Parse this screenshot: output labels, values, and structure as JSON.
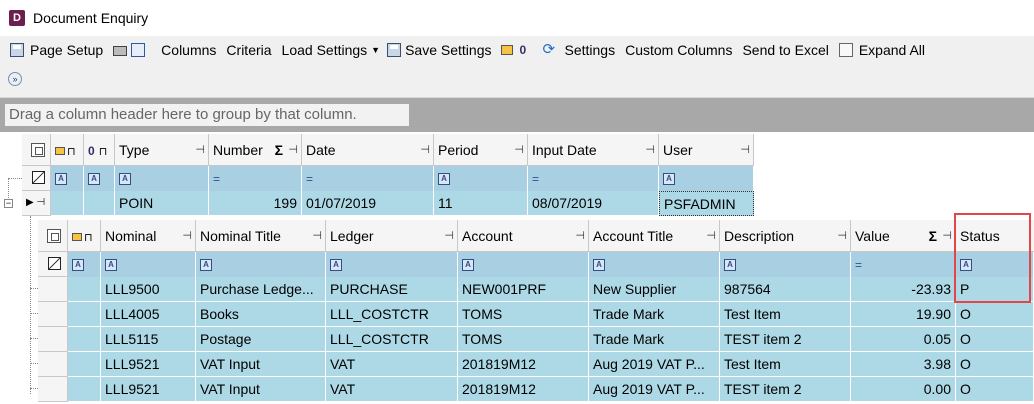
{
  "window": {
    "title": "Document Enquiry",
    "app_icon_letter": "D"
  },
  "toolbar": {
    "page_setup": "Page Setup",
    "columns": "Columns",
    "criteria": "Criteria",
    "load_settings": "Load Settings",
    "save_settings": "Save Settings",
    "zero_indicator": "0",
    "settings": "Settings",
    "custom_columns": "Custom Columns",
    "send_to_excel": "Send to Excel",
    "expand_all": "Expand All"
  },
  "group_panel": {
    "placeholder": "Drag a column header here to group by that column."
  },
  "master_grid": {
    "columns": [
      "Type",
      "Number",
      "Date",
      "Period",
      "Input Date",
      "User"
    ],
    "extra_col_label": "0",
    "row": {
      "type": "POIN",
      "number": "199",
      "date": "01/07/2019",
      "period": "11",
      "input_date": "08/07/2019",
      "user": "PSFADMIN"
    }
  },
  "detail_grid": {
    "columns": [
      "Nominal",
      "Nominal Title",
      "Ledger",
      "Account",
      "Account Title",
      "Description",
      "Value",
      "Status"
    ],
    "rows": [
      {
        "nominal": "LLL9500",
        "nominal_title": "Purchase  Ledge...",
        "ledger": "PURCHASE",
        "account": "NEW001PRF",
        "account_title": "New Supplier",
        "description": "987564",
        "value": "-23.93",
        "status": "P"
      },
      {
        "nominal": "LLL4005",
        "nominal_title": "Books",
        "ledger": "LLL_COSTCTR",
        "account": "TOMS",
        "account_title": "Trade Mark",
        "description": "Test Item",
        "value": "19.90",
        "status": "O"
      },
      {
        "nominal": "LLL5115",
        "nominal_title": "Postage",
        "ledger": "LLL_COSTCTR",
        "account": "TOMS",
        "account_title": "Trade Mark",
        "description": "TEST item 2",
        "value": "0.05",
        "status": "O"
      },
      {
        "nominal": "LLL9521",
        "nominal_title": "VAT Input",
        "ledger": "VAT",
        "account": "201819M12",
        "account_title": "Aug 2019 VAT P...",
        "description": "Test Item",
        "value": "3.98",
        "status": "O"
      },
      {
        "nominal": "LLL9521",
        "nominal_title": "VAT Input",
        "ledger": "VAT",
        "account": "201819M12",
        "account_title": "Aug 2019 VAT P...",
        "description": "TEST item 2",
        "value": "0.00",
        "status": "O"
      }
    ]
  },
  "filter_symbols": {
    "icon": "A",
    "equals": "="
  },
  "colors": {
    "row_bg": "#add8e6",
    "filter_bg": "#a8d0e2",
    "highlight": "#e34646",
    "group_panel": "#a8a8a8"
  }
}
